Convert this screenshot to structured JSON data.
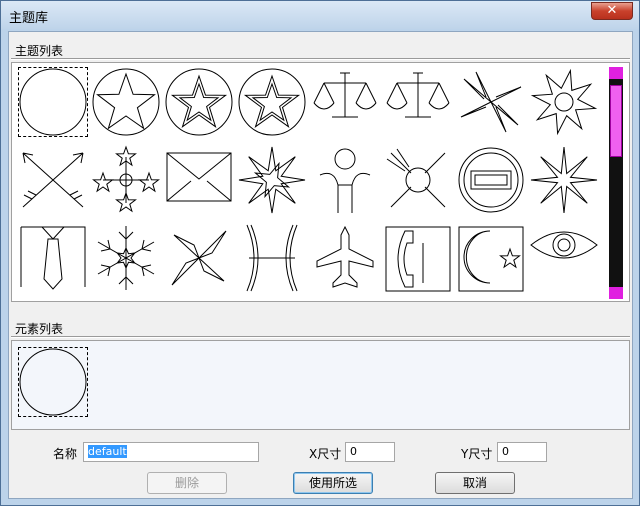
{
  "window": {
    "title": "主题库",
    "close_glyph": "✕"
  },
  "theme_list": {
    "title": "主题列表",
    "items": [
      {
        "icon": "circle-icon",
        "selected": true
      },
      {
        "icon": "star-in-circle-icon"
      },
      {
        "icon": "double-star-circle-icon"
      },
      {
        "icon": "double-star-circle-icon"
      },
      {
        "icon": "balance-scale-icon"
      },
      {
        "icon": "balance-scale-icon"
      },
      {
        "icon": "pinwheel-icon"
      },
      {
        "icon": "sun-rays-icon"
      },
      {
        "icon": "crossed-arrows-icon"
      },
      {
        "icon": "star-cluster-icon"
      },
      {
        "icon": "envelope-icon"
      },
      {
        "icon": "compass-star-icon"
      },
      {
        "icon": "person-figure-icon"
      },
      {
        "icon": "x-circle-icon"
      },
      {
        "icon": "no-entry-sign-icon"
      },
      {
        "icon": "eight-point-star-icon"
      },
      {
        "icon": "necktie-icon"
      },
      {
        "icon": "snowflake-icon"
      },
      {
        "icon": "windmill-icon"
      },
      {
        "icon": "pisces-icon"
      },
      {
        "icon": "airplane-icon"
      },
      {
        "icon": "telephone-icon"
      },
      {
        "icon": "crescent-star-icon"
      },
      {
        "icon": "eye-icon"
      }
    ]
  },
  "element_list": {
    "title": "元素列表",
    "items": [
      {
        "icon": "circle-icon",
        "selected": true
      }
    ]
  },
  "form": {
    "name_label": "名称",
    "name_value": "default",
    "x_label": "X尺寸",
    "x_value": "0",
    "y_label": "Y尺寸",
    "y_value": "0"
  },
  "buttons": {
    "delete": "删除",
    "use_selected": "使用所选",
    "cancel": "取消"
  }
}
